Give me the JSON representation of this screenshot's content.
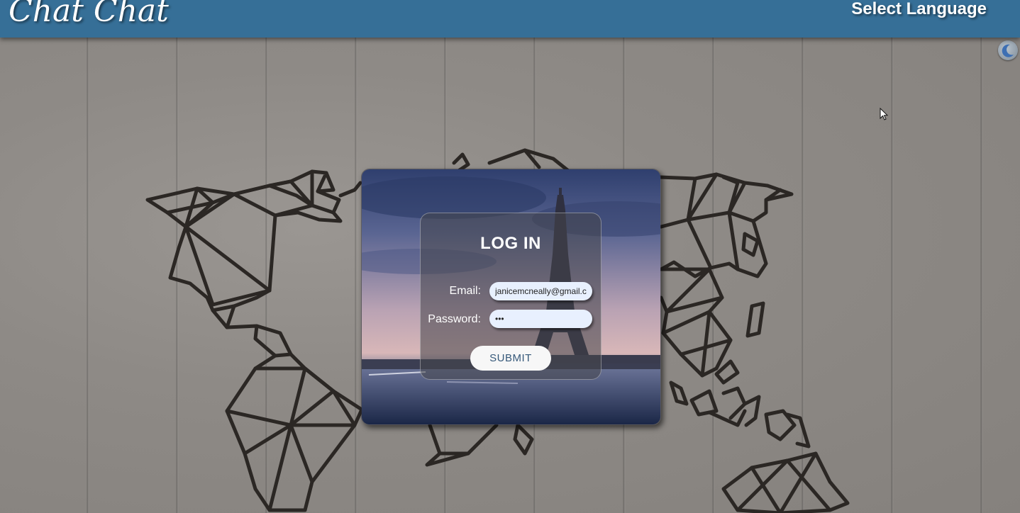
{
  "header": {
    "brand": "Chat Chat",
    "language_button": "Select Language"
  },
  "login": {
    "title": "LOG IN",
    "email_label": "Email:",
    "email_value": "janicemcneally@gmail.com",
    "password_label": "Password:",
    "password_value": "•••",
    "submit_label": "SUBMIT"
  },
  "icons": {
    "theme_toggle": "moon-icon",
    "cursor": "mouse-cursor-icon"
  },
  "colors": {
    "header_bg": "#366f97",
    "page_bg": "#8f8b87",
    "input_bg": "#e8f0fe",
    "submit_text": "#36597a"
  }
}
